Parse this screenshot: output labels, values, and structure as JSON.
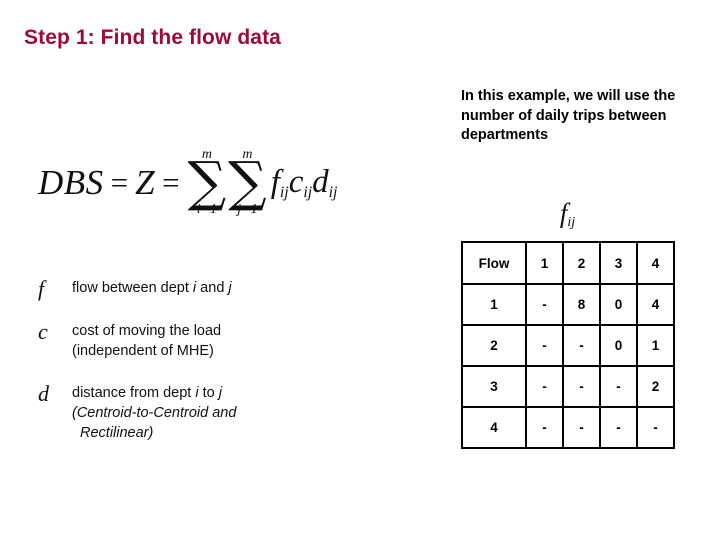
{
  "slide": {
    "title": "Step 1: Find the flow data",
    "title_color": "#9E0B38",
    "background_color": "#FFFFFF"
  },
  "formula": {
    "lhs": "DBS",
    "equals": "=",
    "objective": "Z",
    "equals2": "=",
    "sum_outer": {
      "symbol": "∑",
      "upper": "m",
      "lower": "i=1"
    },
    "sum_inner": {
      "symbol": "∑",
      "upper": "m",
      "lower": "j=1"
    },
    "term_f": "f",
    "term_f_sub": "ij",
    "term_c": "c",
    "term_c_sub": "ij",
    "term_d": "d",
    "term_d_sub": "ij"
  },
  "note": {
    "text": "In this example, we will use the number of daily trips between departments"
  },
  "fij_caption": {
    "symbol": "f",
    "subscript": "ij"
  },
  "legend": {
    "items": [
      {
        "symbol": "f",
        "line1_pre": "flow between dept ",
        "line1_i": "i",
        "line1_mid": " and ",
        "line1_j": "j",
        "line2": "",
        "line3": ""
      },
      {
        "symbol": "c",
        "line1_pre": "cost of moving the load",
        "line1_i": "",
        "line1_mid": "",
        "line1_j": "",
        "line2": "(independent of MHE)",
        "line3": ""
      },
      {
        "symbol": "d",
        "line1_pre": "distance from dept ",
        "line1_i": "i",
        "line1_mid": " to ",
        "line1_j": "j",
        "line2": "(Centroid-to-Centroid and",
        "line3": "Rectilinear)"
      }
    ]
  },
  "chart_data": {
    "type": "table",
    "title": "f ij",
    "columns": [
      "Flow",
      "1",
      "2",
      "3",
      "4"
    ],
    "rows": [
      [
        "1",
        "-",
        "8",
        "0",
        "4"
      ],
      [
        "2",
        "-",
        "-",
        "0",
        "1"
      ],
      [
        "3",
        "-",
        "-",
        "-",
        "2"
      ],
      [
        "4",
        "-",
        "-",
        "-",
        "-"
      ]
    ]
  }
}
